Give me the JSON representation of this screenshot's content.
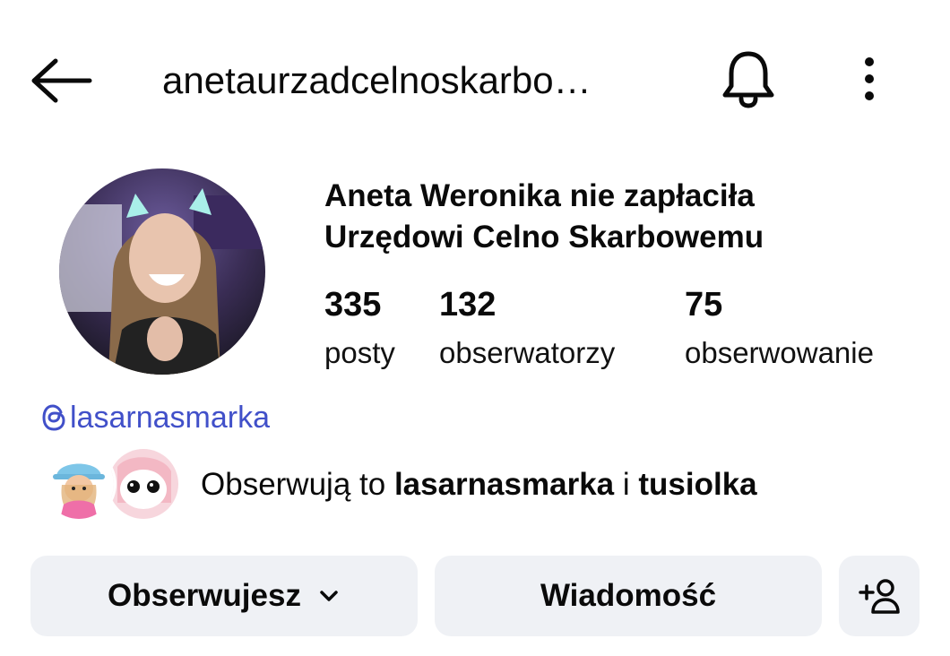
{
  "header": {
    "username": "anetaurzadcelnoskarbo…",
    "icons": [
      "back-arrow-icon",
      "bell-icon",
      "more-vertical-icon"
    ]
  },
  "profile": {
    "display_name_line1": "Aneta Weronika nie zapłaciła",
    "display_name_line2": "Urzędowi Celno Skarbowemu",
    "stats": [
      {
        "value": "335",
        "label": "posty"
      },
      {
        "value": "132",
        "label": "obserwatorzy"
      },
      {
        "value": "75",
        "label": "obserwowanie"
      }
    ],
    "threads_handle": "lasarnasmarka",
    "followed_by": {
      "prefix": "Obserwują to ",
      "user1": "lasarnasmarka",
      "joiner": " i ",
      "user2": "tusiolka"
    }
  },
  "actions": {
    "follow_label": "Obserwujesz",
    "message_label": "Wiadomość"
  },
  "colors": {
    "link": "#4150c9",
    "button_bg": "#eff1f5",
    "text": "#0a0a0a"
  }
}
